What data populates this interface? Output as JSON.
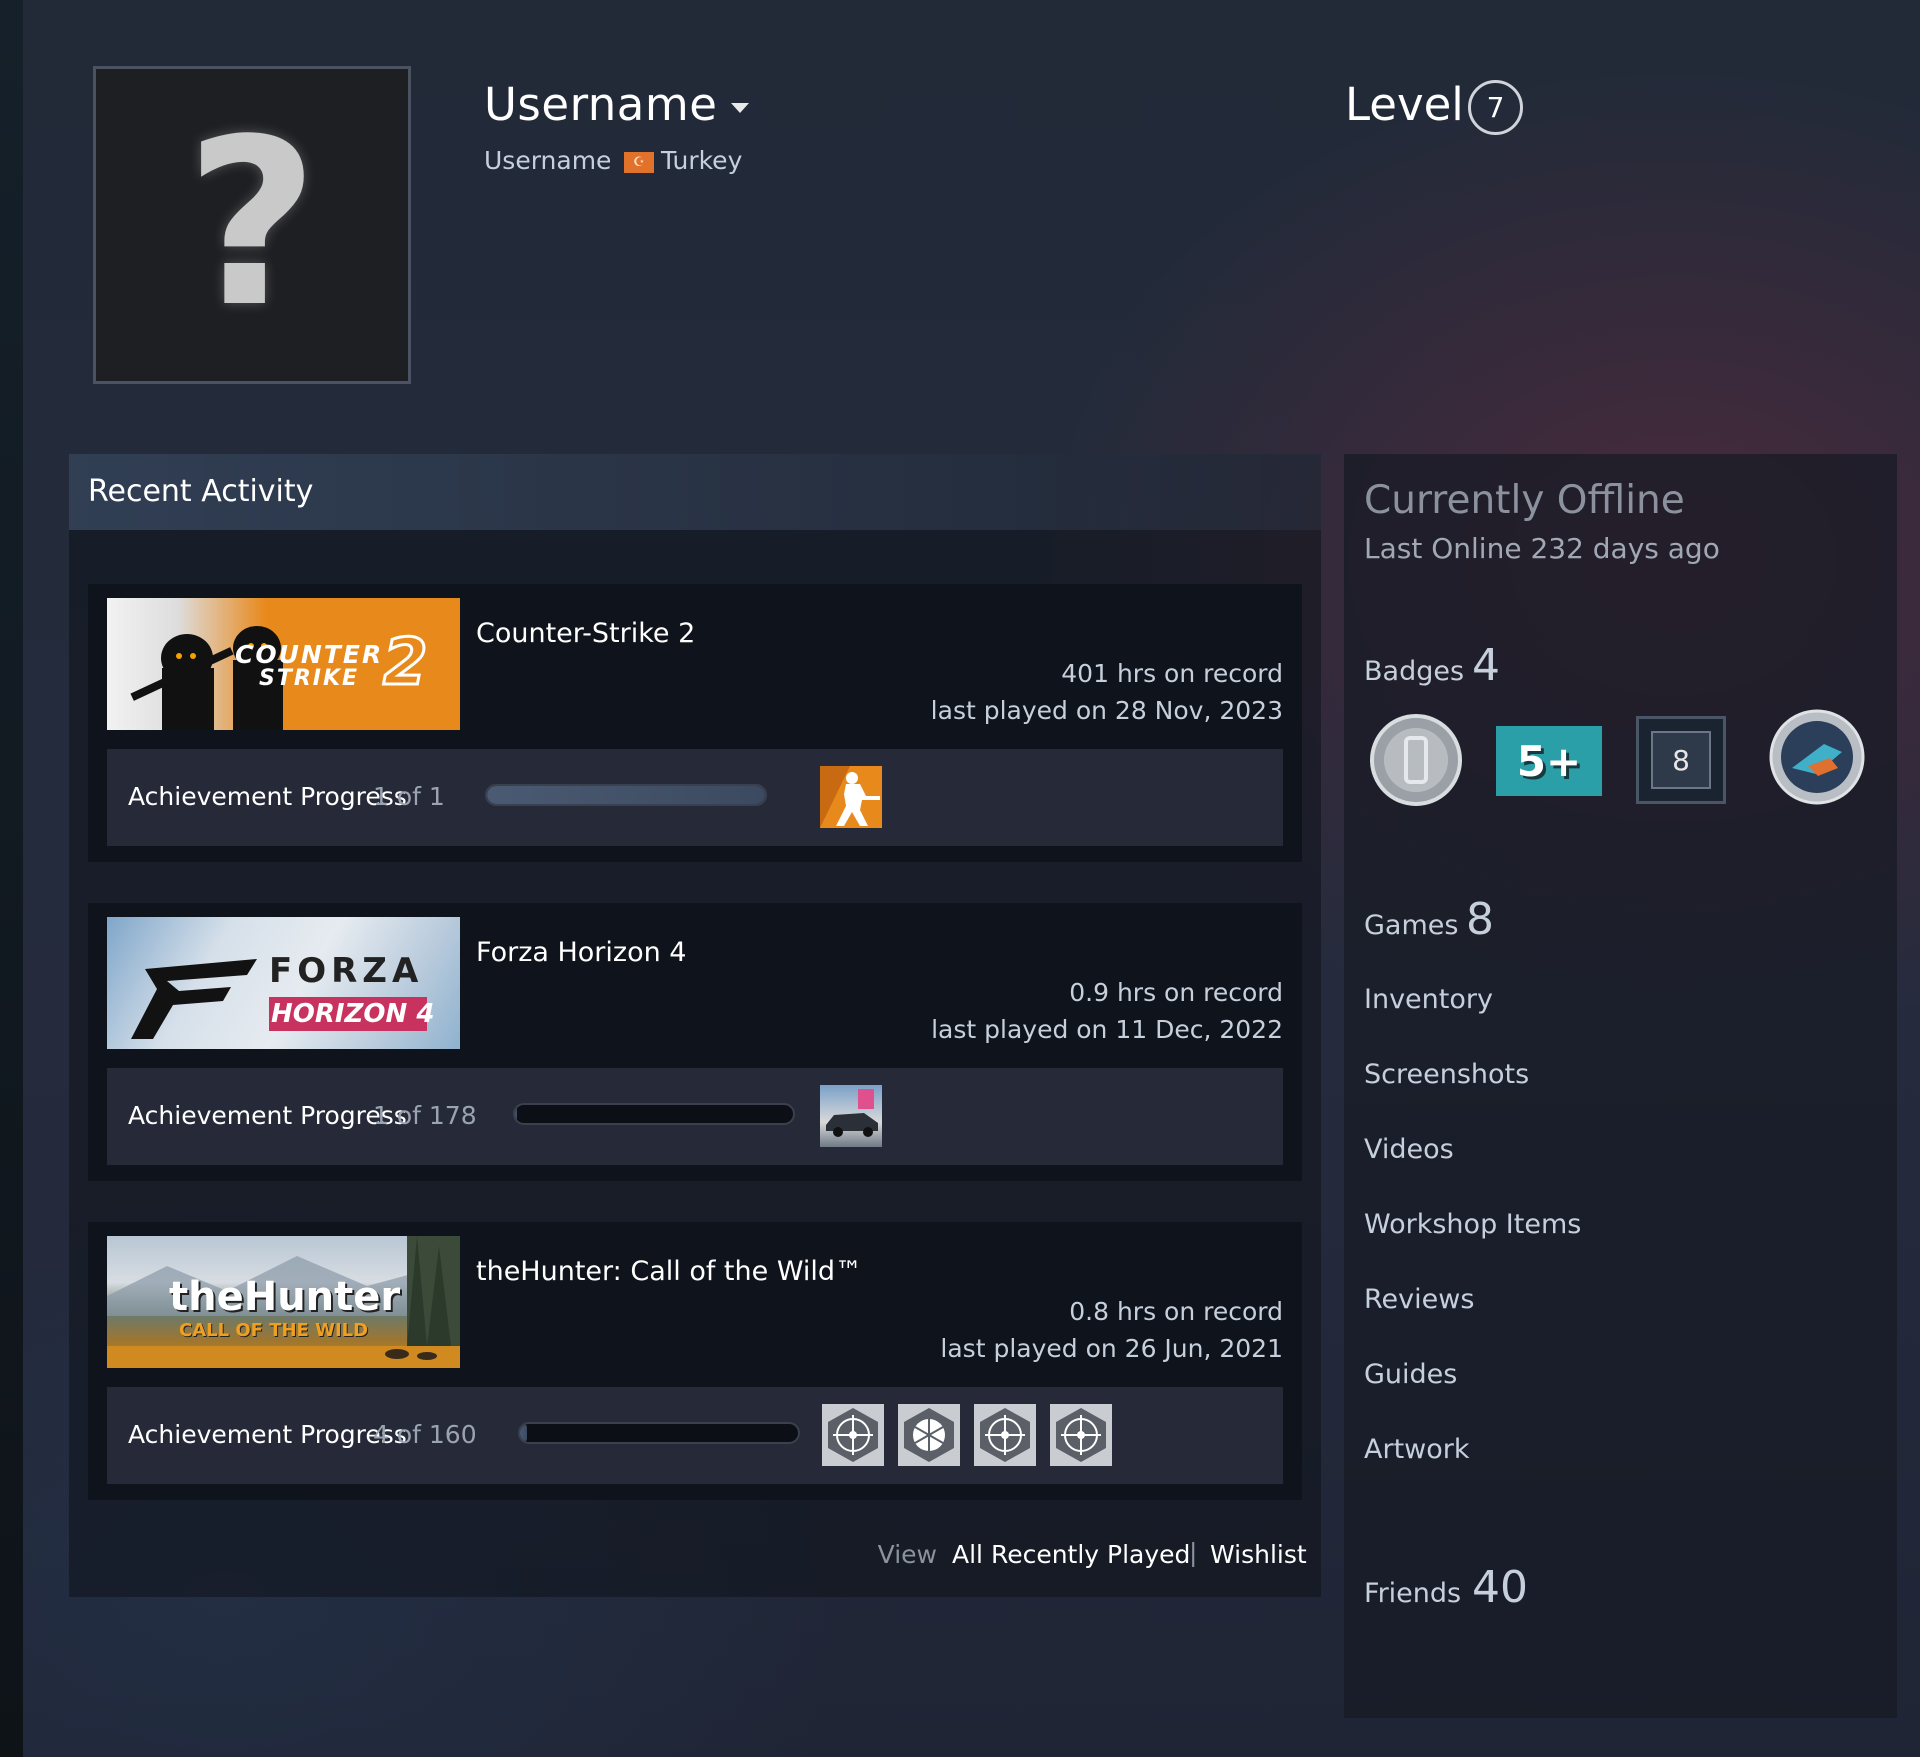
{
  "profile": {
    "username": "Username",
    "real_name": "Username",
    "country": "Turkey",
    "level_label": "Level",
    "level": "7"
  },
  "recent_activity": {
    "title": "Recent Activity",
    "games": [
      {
        "name": "Counter-Strike 2",
        "hours": "401 hrs on record",
        "last_played": "last played on 28 Nov, 2023",
        "ach_label": "Achievement Progress",
        "ach_count": "1 of 1",
        "ach_fraction": 1.0,
        "banner_text": [
          "COUNTER",
          "STRIKE",
          "2"
        ]
      },
      {
        "name": "Forza Horizon 4",
        "hours": "0.9 hrs on record",
        "last_played": "last played on 11 Dec, 2022",
        "ach_label": "Achievement Progress",
        "ach_count": "1 of 178",
        "ach_fraction": 0.0056,
        "banner_text": [
          "FORZA",
          "HORIZON 4"
        ]
      },
      {
        "name": "theHunter: Call of the Wild™",
        "hours": "0.8 hrs on record",
        "last_played": "last played on 26 Jun, 2021",
        "ach_label": "Achievement Progress",
        "ach_count": "4 of 160",
        "ach_fraction": 0.025,
        "banner_text": [
          "theHunter",
          "CALL OF THE WILD"
        ]
      }
    ],
    "view_word": "View",
    "view_all": "All Recently Played",
    "separator": "|",
    "wishlist": "Wishlist"
  },
  "sidebar": {
    "status": "Currently Offline",
    "last_online": "Last Online 232 days ago",
    "badges_label": "Badges",
    "badges_count": "4",
    "badge_5plus": "5+",
    "badge_8": "8",
    "games_label": "Games",
    "games_count": "8",
    "links": [
      "Inventory",
      "Screenshots",
      "Videos",
      "Workshop Items",
      "Reviews",
      "Guides",
      "Artwork"
    ],
    "friends_label": "Friends",
    "friends_count": "40"
  },
  "colors": {
    "accent_orange": "#e8891c",
    "text_primary": "#ffffff",
    "text_secondary": "#c6d0dc",
    "text_muted": "#8b929e"
  }
}
